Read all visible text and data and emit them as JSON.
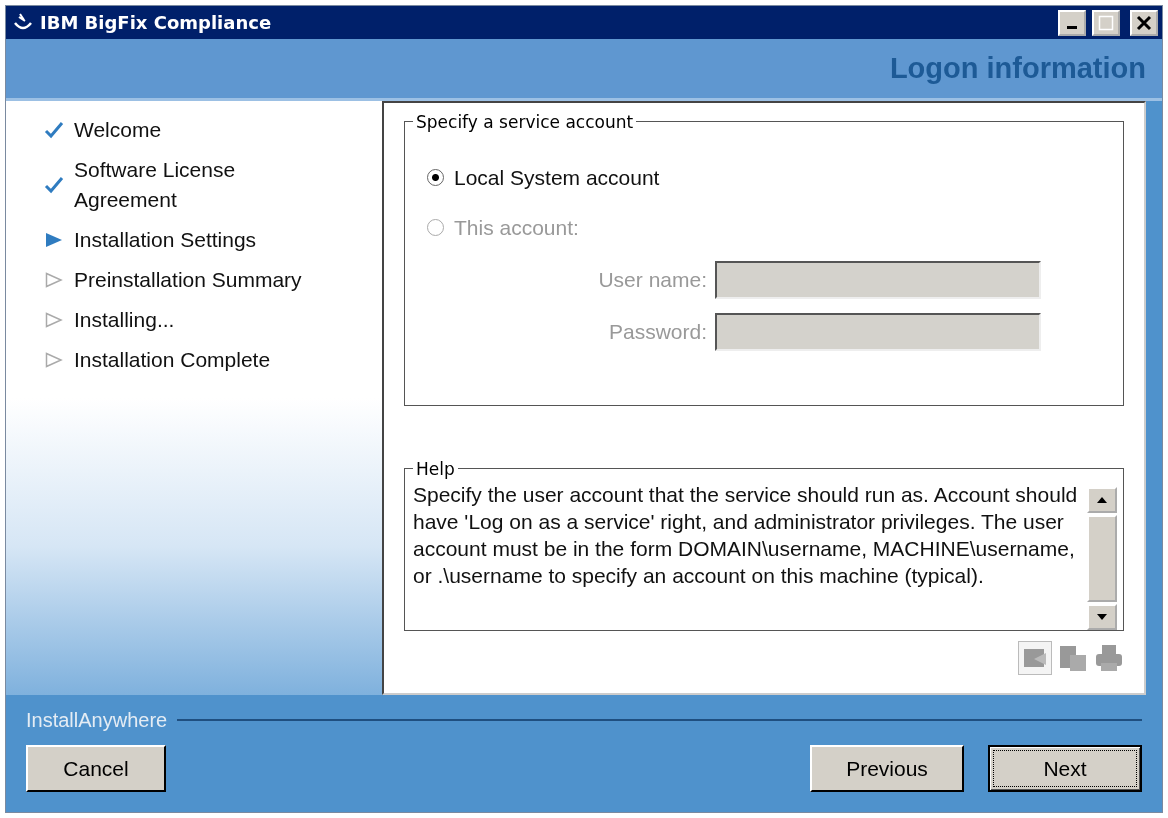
{
  "window": {
    "title": "IBM BigFix Compliance"
  },
  "header": {
    "title": "Logon information"
  },
  "steps": [
    {
      "label": "Welcome",
      "kind": "done"
    },
    {
      "label": "Software License Agreement",
      "kind": "done"
    },
    {
      "label": "Installation Settings",
      "kind": "current"
    },
    {
      "label": "Preinstallation Summary",
      "kind": "pending"
    },
    {
      "label": "Installing...",
      "kind": "pending"
    },
    {
      "label": "Installation Complete",
      "kind": "pending"
    }
  ],
  "account_group": {
    "legend": "Specify a service account",
    "options": [
      {
        "label": "Local System account",
        "selected": true,
        "disabled": false
      },
      {
        "label": "This account:",
        "selected": false,
        "disabled": true
      }
    ],
    "fields": [
      {
        "label": "User name:",
        "disabled": true
      },
      {
        "label": "Password:",
        "disabled": true
      }
    ]
  },
  "help": {
    "legend": "Help",
    "text": "Specify the user account that the service should run as. Account should have 'Log on as a service' right, and administrator privileges. The user account must be in the form DOMAIN\\username, MACHINE\\username, or .\\username to specify an account on this machine (typical)."
  },
  "footer": {
    "brand": "InstallAnywhere",
    "buttons": [
      {
        "label": "Cancel",
        "focused": false
      },
      {
        "label": "Previous",
        "focused": false
      },
      {
        "label": "Next",
        "focused": true
      }
    ]
  }
}
